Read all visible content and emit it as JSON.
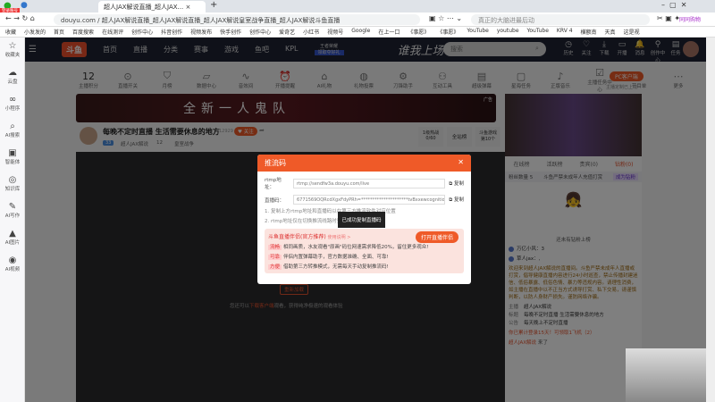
{
  "browser": {
    "profile_badge": "登录账号",
    "tab_title": "超人JAX解说直播_超人JAX...",
    "new_tab": "+",
    "url": "douyu.com / 超人JAX解说直播_超人JAX解说直播_超人JAX解说皇室战争直播_超人JAX解说斗鱼直播",
    "search_placeholder": "真正的大脑进最后动",
    "ext_label": "同同购物",
    "bookmarks": [
      "收藏",
      "小发发的",
      "首页",
      "百度搜索",
      "在线测评",
      "创作中心",
      "抖音创作",
      "视频发布",
      "快手创作",
      "创作中心",
      "爱奇艺",
      "小红书",
      "视频号",
      "Google",
      "在上一口",
      "《事愿》",
      "《事愿》",
      "YouTube",
      "youtube",
      "YouTube",
      "KRV 4",
      "横额南",
      "天真",
      "这是视"
    ]
  },
  "sidebar": [
    {
      "icon": "star",
      "label": "收藏夹"
    },
    {
      "icon": "cloud",
      "label": "云盘"
    },
    {
      "icon": "link",
      "label": "小程序"
    },
    {
      "icon": "search",
      "label": "AI搜索"
    },
    {
      "icon": "bot",
      "label": "智能体"
    },
    {
      "icon": "target",
      "label": "知识库"
    },
    {
      "icon": "edit",
      "label": "AI写作"
    },
    {
      "icon": "image",
      "label": "AI图片"
    },
    {
      "icon": "video",
      "label": "AI视频"
    }
  ],
  "header": {
    "logo": "斗鱼",
    "nav": [
      "首页",
      "直播",
      "分类",
      "赛事",
      "游戏",
      "鱼吧",
      "KPL"
    ],
    "promo_top": "王者荣耀",
    "promo_bottom": "领取夺好礼",
    "slogan": "谁我上场",
    "search_placeholder": "搜索",
    "icons": [
      {
        "icon": "clock",
        "label": "历史"
      },
      {
        "icon": "heart",
        "label": "关注"
      },
      {
        "icon": "download",
        "label": "下载"
      },
      {
        "icon": "broadcast",
        "label": "开播"
      },
      {
        "icon": "bell",
        "label": "消息"
      },
      {
        "icon": "pin",
        "label": "创作中心"
      },
      {
        "icon": "clipboard",
        "label": "任务"
      }
    ]
  },
  "tools": {
    "points": "12",
    "points_label": "主播积分",
    "items": [
      "直播开关",
      "月榜",
      "数据中心",
      "音效间",
      "开播提醒",
      "AI礼物",
      "礼物投票",
      "刀锋助手",
      "互动工具",
      "超级弹幕",
      "星海任务",
      "正版音乐",
      "主播任务中心",
      "节目单",
      "更多"
    ],
    "pc_client": "PC客户端",
    "pc_note": "主播定制已上线"
  },
  "banner": {
    "title": "全新一人鬼队",
    "ad": "广告"
  },
  "streamer": {
    "title": "每晚不定时直播 生活需要休息的地方",
    "room_id": "12929",
    "follow": "关注",
    "name": "超人JAX解说",
    "likes": "12",
    "category": "皇室战争",
    "level": "33",
    "hot_label": "1级热战",
    "hot_value": "0/60",
    "rank": "全站榜",
    "fish_label": "斗鱼游戏",
    "fish_value": "第10个"
  },
  "video": {
    "reload": "重新加载",
    "notice_pre": "您还可以",
    "notice_link": "下载客户端",
    "notice_post": "观看，获得纯净极速的观看体验"
  },
  "modal": {
    "title": "推流码",
    "rtmp_label": "rtmp地址：",
    "rtmp_value": "rtmp://sendfw3a.douyu.com/live",
    "key_label": "直播码：",
    "key_value": "6771569OQRcdXgxFdyPRh=*********************tvBxxewcognition=",
    "copy": "复制",
    "tip1": "1. 复制上方rtmp地址和直播码以在第三方推流软件对应位置",
    "tip2": "2. rtmp地址仅在切换推流线路时更新，有效期为5分钟",
    "promo_title": "斗鱼直播伴侣(官方推荐)",
    "promo_link": "使用说明 >",
    "open_btn": "打开直播伴侣",
    "features": [
      {
        "tag": "流畅",
        "text": "相同画质，水友观看\"原画\"码位网速需求降低20%，留住更多观众!"
      },
      {
        "tag": "可靠",
        "text": "伴侣内置弹幕助手，官方数据准确、全面、可靠!"
      },
      {
        "tag": "方便",
        "text": "借助第三方转推模式，无需每天手动复制推流码!"
      }
    ]
  },
  "toast": "已成功复制直播码",
  "right": {
    "tabs": [
      "在线榜",
      "活跃榜",
      "贵宾(0)",
      "钻粉(0)"
    ],
    "fan_bar": "粉丝数量 5",
    "fan_note": "斗鱼严禁未成年人充值打赏",
    "become_fan": "成为钻粉",
    "empty": "还未有钻粉上榜",
    "chat": [
      {
        "user": "万亿小风：3"
      },
      {
        "user": "草人jax：,"
      }
    ],
    "announce": "欢迎来到超人JAX解说的直播间。斗鱼严禁未成年人直播或打赏，倡导健康直播内容进行24小时巡查，禁止传播封建迷信、低俗暴露、低俗色情、暴力等违规内容。请理性消费，如主播在直播中以不正当方式诱导打赏、私下交易，请谨慎判断，以防人身财产损失。谨防网络诈骗。",
    "meta": [
      {
        "k": "主播",
        "v": "超人JAX解说"
      },
      {
        "k": "标题",
        "v": "每晚不定时直播 生活需要休息的地方"
      },
      {
        "k": "公告",
        "v": "每天晚上不定时直播"
      }
    ],
    "login_msg": "你已累计登录15天！可领取1飞机（2）",
    "arrive_user": "超人JAX解说",
    "arrive_text": "来了"
  }
}
